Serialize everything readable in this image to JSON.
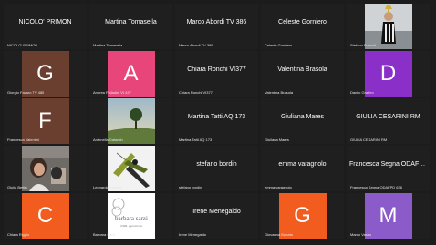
{
  "tiles": [
    {
      "label": "NICOLO' PRIMON",
      "center_name": "NICOLO' PRIMON",
      "kind": "name"
    },
    {
      "label": "Martina Tomasella",
      "center_name": "Martina Tomasella",
      "kind": "name"
    },
    {
      "label": "Marco Abordi TV 386",
      "center_name": "Marco Abordi TV 386",
      "kind": "name"
    },
    {
      "label": "Celeste Gorniero",
      "center_name": "Celeste Gorniero",
      "kind": "name"
    },
    {
      "label": "Stefano Franchi",
      "kind": "photo",
      "photo": "soccer-player-photo"
    },
    {
      "label": "Giorgio Favaro TV 485",
      "kind": "avatar",
      "letter": "G",
      "color": "#6b3f2f"
    },
    {
      "label": "Andrea Palladini VI 437",
      "kind": "avatar",
      "letter": "A",
      "color": "#e8457a"
    },
    {
      "label": "Chiara Ronchi VI377",
      "center_name": "Chiara Ronchi VI377",
      "kind": "name"
    },
    {
      "label": "Valentina Brasola",
      "center_name": "Valentina Brasola",
      "kind": "name"
    },
    {
      "label": "Danilo Graffeo",
      "kind": "avatar",
      "letter": "D",
      "color": "#8b2fc9"
    },
    {
      "label": "Francesca Valentini",
      "kind": "avatar",
      "letter": "F",
      "color": "#6b3f2f"
    },
    {
      "label": "Antonella Galamin",
      "kind": "photo",
      "photo": "landscape-tree-photo"
    },
    {
      "label": "Martina Tatti AQ 173",
      "center_name": "Martina Tatti AQ 173",
      "kind": "name"
    },
    {
      "label": "Giuliana Mares",
      "center_name": "Giuliana Mares",
      "kind": "name"
    },
    {
      "label": "GIULIA CESARINI RM",
      "center_name": "GIULIA CESARINI RM",
      "kind": "name"
    },
    {
      "label": "Giulia Bettin",
      "kind": "photo",
      "photo": "webcam-person-photo"
    },
    {
      "label": "Leonardo Bottacin",
      "kind": "photo",
      "photo": "grasshopper-photo"
    },
    {
      "label": "stefano bordin",
      "center_name": "stefano bordin",
      "kind": "name"
    },
    {
      "label": "emma varagnolo",
      "center_name": "emma varagnolo",
      "kind": "name"
    },
    {
      "label": "Francesca Segna ODAFPD 636",
      "center_name": "Francesca Segna ODAFPD 6...",
      "kind": "name"
    },
    {
      "label": "Chiara Riggio",
      "kind": "avatar",
      "letter": "C",
      "color": "#f25c1f"
    },
    {
      "label": "Barbara Sarzi",
      "kind": "photo",
      "photo": "barbara-sarzi-logo",
      "logo_text": "barbara sarzi",
      "logo_sub": "CWR, agronomist"
    },
    {
      "label": "Irene Menegaldo",
      "center_name": "Irene Menegaldo",
      "kind": "name"
    },
    {
      "label": "Giovanna Bonato",
      "kind": "avatar",
      "letter": "G",
      "color": "#f25c1f"
    },
    {
      "label": "Marco Vasso",
      "kind": "avatar",
      "letter": "M",
      "color": "#8b5cc9"
    }
  ]
}
